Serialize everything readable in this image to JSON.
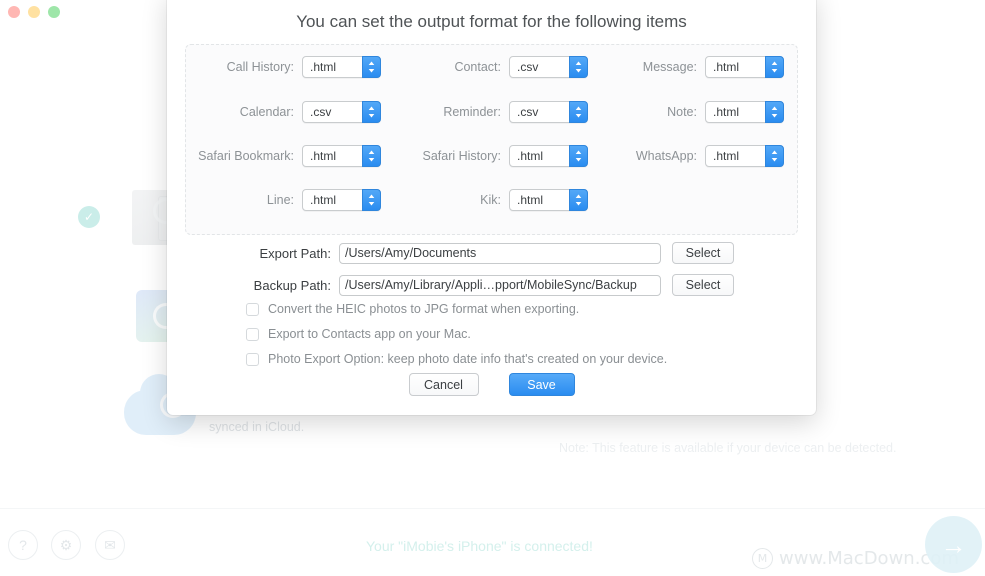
{
  "window": {
    "traffic_lights": [
      "close",
      "minimize",
      "zoom"
    ]
  },
  "background": {
    "synced_text": "synced in iCloud.",
    "note_text": "Note: This feature is available if your device can be detected.",
    "connected_text": "Your \"iMobie's iPhone\" is connected!",
    "watermark_text": "www.MacDown.com",
    "toolbar_icons": [
      "question-icon",
      "gear-icon",
      "mail-icon"
    ],
    "fab_icon": "arrow-right-icon"
  },
  "dialog": {
    "title": "You can set the output format for the following items",
    "format_fields": [
      {
        "label": "Call History:",
        "value": ".html"
      },
      {
        "label": "Contact:",
        "value": ".csv"
      },
      {
        "label": "Message:",
        "value": ".html"
      },
      {
        "label": "Calendar:",
        "value": ".csv"
      },
      {
        "label": "Reminder:",
        "value": ".csv"
      },
      {
        "label": "Note:",
        "value": ".html"
      },
      {
        "label": "Safari Bookmark:",
        "value": ".html"
      },
      {
        "label": "Safari History:",
        "value": ".html"
      },
      {
        "label": "WhatsApp:",
        "value": ".html"
      },
      {
        "label": "Line:",
        "value": ".html"
      },
      {
        "label": "Kik:",
        "value": ".html"
      }
    ],
    "paths": [
      {
        "label": "Export Path:",
        "value": "/Users/Amy/Documents",
        "button_label": "Select"
      },
      {
        "label": "Backup Path:",
        "value": "/Users/Amy/Library/Appli…pport/MobileSync/Backup",
        "button_label": "Select"
      }
    ],
    "checkboxes": [
      {
        "label": "Convert the HEIC photos to JPG format when exporting.",
        "checked": false
      },
      {
        "label": "Export to Contacts app on your Mac.",
        "checked": false
      },
      {
        "label": "Photo Export Option: keep photo date info that's created on your device.",
        "checked": false
      }
    ],
    "cancel_label": "Cancel",
    "save_label": "Save"
  },
  "colors": {
    "accent_blue": "#2a8cf0",
    "title_gray": "#4f5356",
    "label_gray": "#8d9296",
    "connected_teal": "#d4f0ec"
  }
}
